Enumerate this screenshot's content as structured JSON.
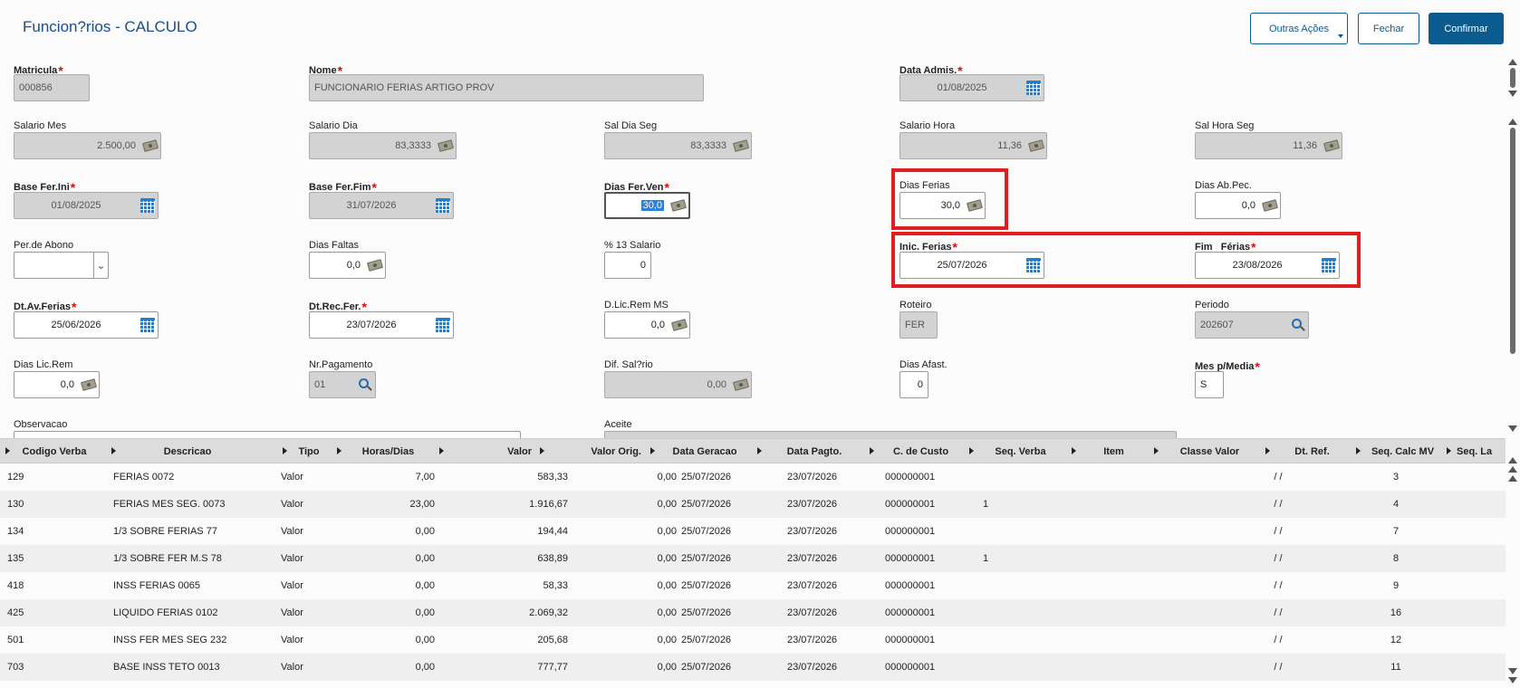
{
  "title": "Funcion?rios - CALCULO",
  "buttons": {
    "more": "Outras Ações",
    "close": "Fechar",
    "confirm": "Confirmar"
  },
  "fields": {
    "matricula": {
      "label": "Matricula",
      "value": "000856"
    },
    "nome": {
      "label": "Nome",
      "value": "FUNCIONARIO FERIAS ARTIGO PROV"
    },
    "data_admis": {
      "label": "Data Admis.",
      "value": "01/08/2025"
    },
    "salario_mes": {
      "label": "Salario Mes",
      "value": "2.500,00"
    },
    "salario_dia": {
      "label": "Salario Dia",
      "value": "83,3333"
    },
    "sal_dia_seg": {
      "label": "Sal Dia Seg",
      "value": "83,3333"
    },
    "salario_hora": {
      "label": "Salario Hora",
      "value": "11,36"
    },
    "sal_hora_seg": {
      "label": "Sal Hora Seg",
      "value": "11,36"
    },
    "base_fer_ini": {
      "label": "Base Fer.Ini",
      "value": "01/08/2025"
    },
    "base_fer_fim": {
      "label": "Base Fer.Fim",
      "value": "31/07/2026"
    },
    "dias_fer_ven": {
      "label": "Dias Fer.Ven",
      "value": "30,0"
    },
    "dias_ferias": {
      "label": "Dias Ferias",
      "value": "30,0"
    },
    "dias_ab_pec": {
      "label": "Dias Ab.Pec.",
      "value": "0,0"
    },
    "per_abono": {
      "label": "Per.de Abono",
      "value": ""
    },
    "dias_faltas": {
      "label": "Dias Faltas",
      "value": "0,0"
    },
    "pct_13": {
      "label": "% 13 Salario",
      "value": "0"
    },
    "inic_ferias": {
      "label": "Inic. Ferias",
      "value": "25/07/2026"
    },
    "fim_ferias": {
      "label": "Fim   Férias",
      "value": "23/08/2026"
    },
    "dt_av_ferias": {
      "label": "Dt.Av.Ferias",
      "value": "25/06/2026"
    },
    "dt_rec_fer": {
      "label": "Dt.Rec.Fer.",
      "value": "23/07/2026"
    },
    "d_lic_rem_ms": {
      "label": "D.Lic.Rem MS",
      "value": "0,0"
    },
    "roteiro": {
      "label": "Roteiro",
      "value": "FER"
    },
    "periodo": {
      "label": "Periodo",
      "value": "202607"
    },
    "dias_lic_rem": {
      "label": "Dias Lic.Rem",
      "value": "0,0"
    },
    "nr_pagamento": {
      "label": "Nr.Pagamento",
      "value": "01"
    },
    "dif_salario": {
      "label": "Dif. Sal?rio",
      "value": "0,00"
    },
    "dias_afast": {
      "label": "Dias Afast.",
      "value": "0"
    },
    "mes_p_media": {
      "label": "Mes p/Media",
      "value": "S"
    },
    "observacao": {
      "label": "Observacao",
      "value": ""
    },
    "aceite": {
      "label": "Aceite",
      "value": ""
    }
  },
  "grid": {
    "columns": [
      "Codigo Verba",
      "Descricao",
      "Tipo",
      "Horas/Dias",
      "Valor",
      "Valor Orig.",
      "Data Geracao",
      "Data Pagto.",
      "C. de Custo",
      "Seq. Verba",
      "Item",
      "Classe Valor",
      "Dt. Ref.",
      "Seq. Calc MV",
      "Seq. La"
    ],
    "rows": [
      [
        "129",
        "FERIAS 0072",
        "Valor",
        "7,00",
        "583,33",
        "0,00",
        "25/07/2026",
        "23/07/2026",
        "000000001",
        "",
        "",
        "",
        "/ /",
        "3"
      ],
      [
        "130",
        "FERIAS MES SEG. 0073",
        "Valor",
        "23,00",
        "1.916,67",
        "0,00",
        "25/07/2026",
        "23/07/2026",
        "000000001",
        "1",
        "",
        "",
        "/ /",
        "4"
      ],
      [
        "134",
        "1/3 SOBRE FERIAS 77",
        "Valor",
        "0,00",
        "194,44",
        "0,00",
        "25/07/2026",
        "23/07/2026",
        "000000001",
        "",
        "",
        "",
        "/ /",
        "7"
      ],
      [
        "135",
        "1/3 SOBRE FER M.S 78",
        "Valor",
        "0,00",
        "638,89",
        "0,00",
        "25/07/2026",
        "23/07/2026",
        "000000001",
        "1",
        "",
        "",
        "/ /",
        "8"
      ],
      [
        "418",
        "INSS FERIAS 0065",
        "Valor",
        "0,00",
        "58,33",
        "0,00",
        "25/07/2026",
        "23/07/2026",
        "000000001",
        "",
        "",
        "",
        "/ /",
        "9"
      ],
      [
        "425",
        "LIQUIDO FERIAS 0102",
        "Valor",
        "0,00",
        "2.069,32",
        "0,00",
        "25/07/2026",
        "23/07/2026",
        "000000001",
        "",
        "",
        "",
        "/ /",
        "16"
      ],
      [
        "501",
        "INSS FER MES SEG 232",
        "Valor",
        "0,00",
        "205,68",
        "0,00",
        "25/07/2026",
        "23/07/2026",
        "000000001",
        "",
        "",
        "",
        "/ /",
        "12"
      ],
      [
        "703",
        "BASE INSS TETO 0013",
        "Valor",
        "0,00",
        "777,77",
        "0,00",
        "25/07/2026",
        "23/07/2026",
        "000000001",
        "",
        "",
        "",
        "/ /",
        "11"
      ]
    ]
  }
}
